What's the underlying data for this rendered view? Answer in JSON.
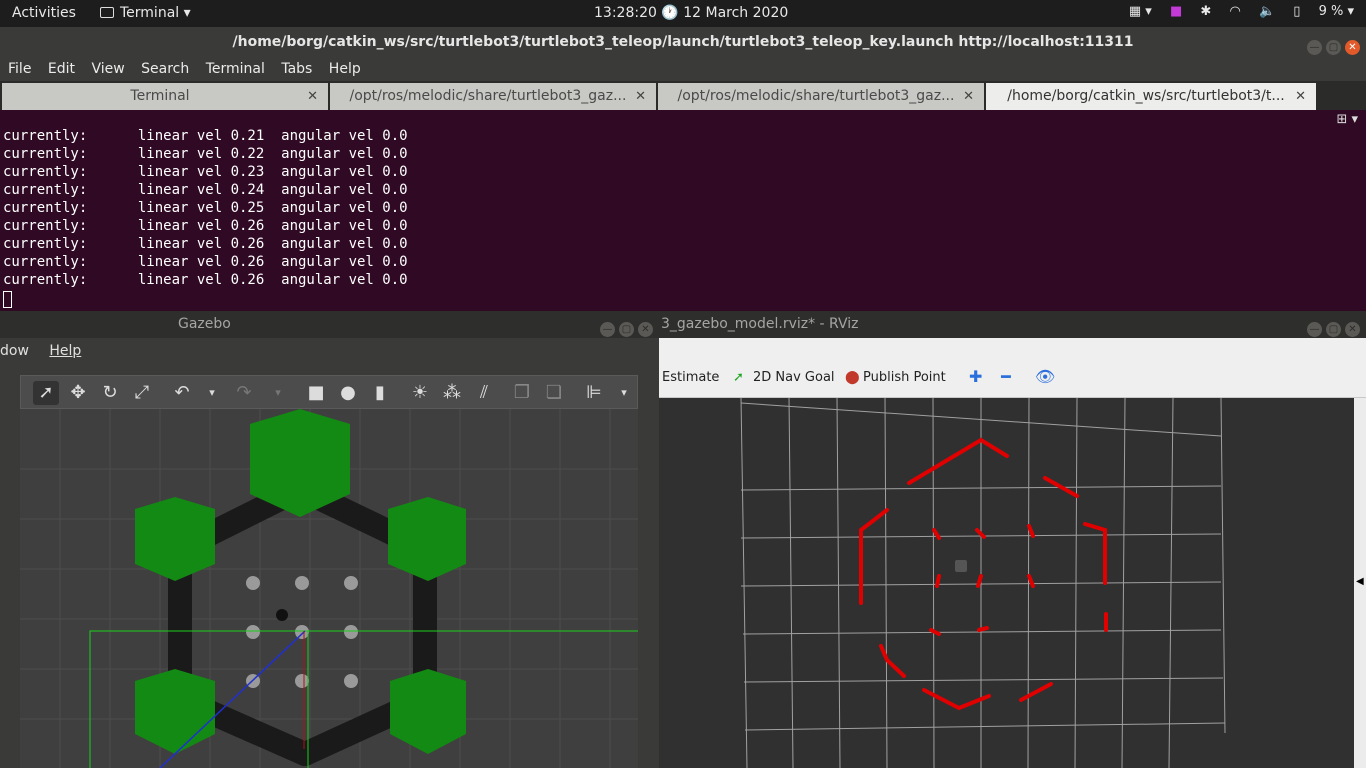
{
  "topbar": {
    "activities": "Activities",
    "app_name": "Terminal",
    "clock": "13:28:20",
    "date": "12 March 2020",
    "battery": "9 %"
  },
  "terminal": {
    "title": "/home/borg/catkin_ws/src/turtlebot3/turtlebot3_teleop/launch/turtlebot3_teleop_key.launch http://localhost:11311",
    "menu": [
      "File",
      "Edit",
      "View",
      "Search",
      "Terminal",
      "Tabs",
      "Help"
    ],
    "tabs": [
      {
        "label": "Terminal",
        "active": false
      },
      {
        "label": "/opt/ros/melodic/share/turtlebot3_gaz...",
        "active": false
      },
      {
        "label": "/opt/ros/melodic/share/turtlebot3_gaz...",
        "active": false
      },
      {
        "label": "/home/borg/catkin_ws/src/turtlebot3/t...",
        "active": true
      }
    ],
    "lines": [
      "currently:\tlinear vel 0.21\t angular vel 0.0",
      "currently:\tlinear vel 0.22\t angular vel 0.0",
      "currently:\tlinear vel 0.23\t angular vel 0.0",
      "currently:\tlinear vel 0.24\t angular vel 0.0",
      "currently:\tlinear vel 0.25\t angular vel 0.0",
      "currently:\tlinear vel 0.26\t angular vel 0.0",
      "currently:\tlinear vel 0.26\t angular vel 0.0",
      "currently:\tlinear vel 0.26\t angular vel 0.0",
      "currently:\tlinear vel 0.26\t angular vel 0.0"
    ]
  },
  "gazebo": {
    "title": "Gazebo",
    "menu": [
      "dow",
      "Help"
    ]
  },
  "rviz": {
    "title": "3_gazebo_model.rviz* - RViz",
    "tools": {
      "estimate": "Estimate",
      "nav_goal": "2D Nav Goal",
      "publish_point": "Publish Point"
    },
    "colors": {
      "scan": "#e00000",
      "grid": "#a0a0a0"
    }
  }
}
